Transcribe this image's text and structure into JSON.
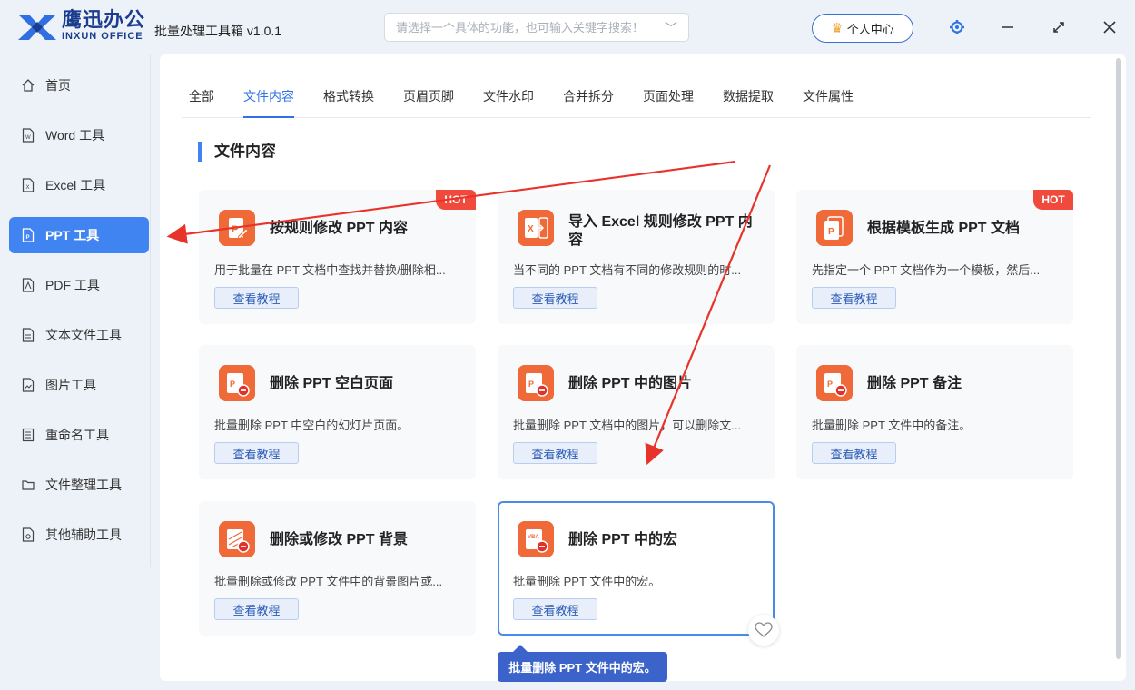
{
  "app": {
    "brand_cn": "鹰迅办公",
    "brand_en": "INXUN OFFICE",
    "title": "批量处理工具箱 v1.0.1",
    "search_placeholder": "请选择一个具体的功能，也可输入关键字搜索！",
    "user_center": "个人中心"
  },
  "sidebar": {
    "items": [
      {
        "label": "首页",
        "icon": "home-icon"
      },
      {
        "label": "Word 工具",
        "icon": "word-file-icon"
      },
      {
        "label": "Excel 工具",
        "icon": "excel-file-icon"
      },
      {
        "label": "PPT 工具",
        "icon": "ppt-file-icon",
        "active": true
      },
      {
        "label": "PDF 工具",
        "icon": "pdf-file-icon"
      },
      {
        "label": "文本文件工具",
        "icon": "text-file-icon"
      },
      {
        "label": "图片工具",
        "icon": "image-file-icon"
      },
      {
        "label": "重命名工具",
        "icon": "rename-icon"
      },
      {
        "label": "文件整理工具",
        "icon": "folder-icon"
      },
      {
        "label": "其他辅助工具",
        "icon": "tools-icon"
      }
    ]
  },
  "tabs": [
    "全部",
    "文件内容",
    "格式转换",
    "页眉页脚",
    "文件水印",
    "合并拆分",
    "页面处理",
    "数据提取",
    "文件属性"
  ],
  "active_tab": "文件内容",
  "section_title": "文件内容",
  "cards": [
    {
      "title": "按规则修改 PPT 内容",
      "desc": "用于批量在 PPT 文档中查找并替换/删除相...",
      "button": "查看教程",
      "badge": "HOT",
      "icon": "ppt-edit-icon"
    },
    {
      "title": "导入 Excel 规则修改 PPT 内容",
      "desc": "当不同的 PPT 文档有不同的修改规则的时...",
      "button": "查看教程",
      "icon": "excel-import-icon"
    },
    {
      "title": "根据模板生成 PPT 文档",
      "desc": "先指定一个 PPT 文档作为一个模板，然后...",
      "button": "查看教程",
      "badge": "HOT",
      "icon": "ppt-template-icon"
    },
    {
      "title": "删除 PPT 空白页面",
      "desc": "批量删除 PPT 中空白的幻灯片页面。",
      "button": "查看教程",
      "icon": "ppt-delete-icon"
    },
    {
      "title": "删除 PPT 中的图片",
      "desc": "批量删除 PPT 文档中的图片，可以删除文...",
      "button": "查看教程",
      "icon": "ppt-delete-icon"
    },
    {
      "title": "删除 PPT 备注",
      "desc": "批量删除 PPT 文件中的备注。",
      "button": "查看教程",
      "icon": "ppt-delete-icon"
    },
    {
      "title": "删除或修改 PPT 背景",
      "desc": "批量删除或修改 PPT 文件中的背景图片或...",
      "button": "查看教程",
      "icon": "ppt-background-icon"
    },
    {
      "title": "删除 PPT 中的宏",
      "desc": "批量删除 PPT 文件中的宏。",
      "button": "查看教程",
      "icon": "ppt-macro-icon",
      "selected": true
    }
  ],
  "tooltip": "批量删除 PPT 文件中的宏。",
  "colors": {
    "accent": "#3f84f0",
    "icon_orange": "#ef6a38",
    "hot_red": "#f04a3c",
    "annotation_arrow": "#e8332a"
  }
}
